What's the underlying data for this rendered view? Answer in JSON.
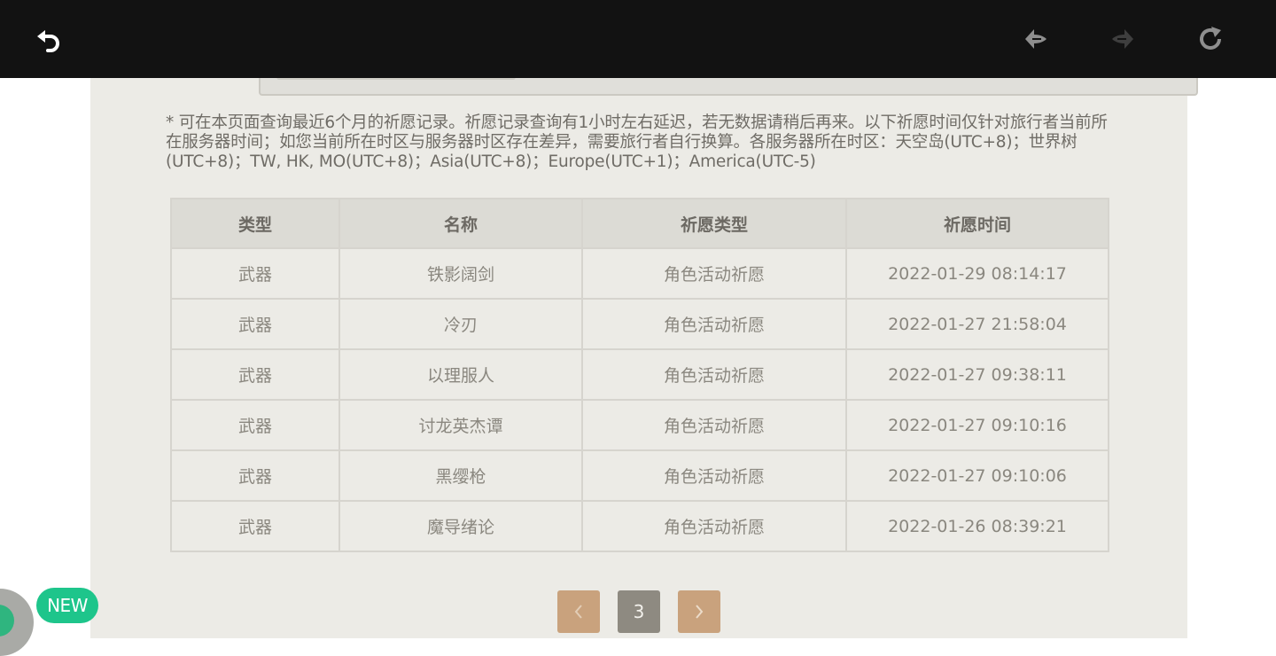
{
  "notice_text": "* 可在本页面查询最近6个月的祈愿记录。祈愿记录查询有1小时左右延迟，若无数据请稍后再来。以下祈愿时间仅针对旅行者当前所在服务器时间；如您当前所在时区与服务器时区存在差异，需要旅行者自行换算。各服务器所在时区：天空岛(UTC+8)；世界树(UTC+8)；TW, HK, MO(UTC+8)；Asia(UTC+8)；Europe(UTC+1)；America(UTC-5)",
  "table": {
    "headers": [
      "类型",
      "名称",
      "祈愿类型",
      "祈愿时间"
    ],
    "rows": [
      [
        "武器",
        "铁影阔剑",
        "角色活动祈愿",
        "2022-01-29 08:14:17"
      ],
      [
        "武器",
        "冷刃",
        "角色活动祈愿",
        "2022-01-27 21:58:04"
      ],
      [
        "武器",
        "以理服人",
        "角色活动祈愿",
        "2022-01-27 09:38:11"
      ],
      [
        "武器",
        "讨龙英杰谭",
        "角色活动祈愿",
        "2022-01-27 09:10:16"
      ],
      [
        "武器",
        "黑缨枪",
        "角色活动祈愿",
        "2022-01-27 09:10:06"
      ],
      [
        "武器",
        "魔导绪论",
        "角色活动祈愿",
        "2022-01-26 08:39:21"
      ]
    ]
  },
  "pagination": {
    "current_page": "3",
    "prev_icon": "chevron-left-icon",
    "next_icon": "chevron-right-icon"
  },
  "topbar": {
    "back_icon": "back-arrow-icon",
    "nav_back_icon": "nav-back-icon",
    "nav_forward_icon": "nav-forward-icon",
    "refresh_icon": "refresh-icon"
  },
  "badge": {
    "label": "NEW"
  },
  "colors": {
    "topbar": "#121212",
    "panel": "#ecebe6",
    "header_row": "#dcdbd5",
    "pager_accent": "#c9a27d",
    "pager_current": "#8e8a81",
    "badge": "#1ec58b"
  }
}
